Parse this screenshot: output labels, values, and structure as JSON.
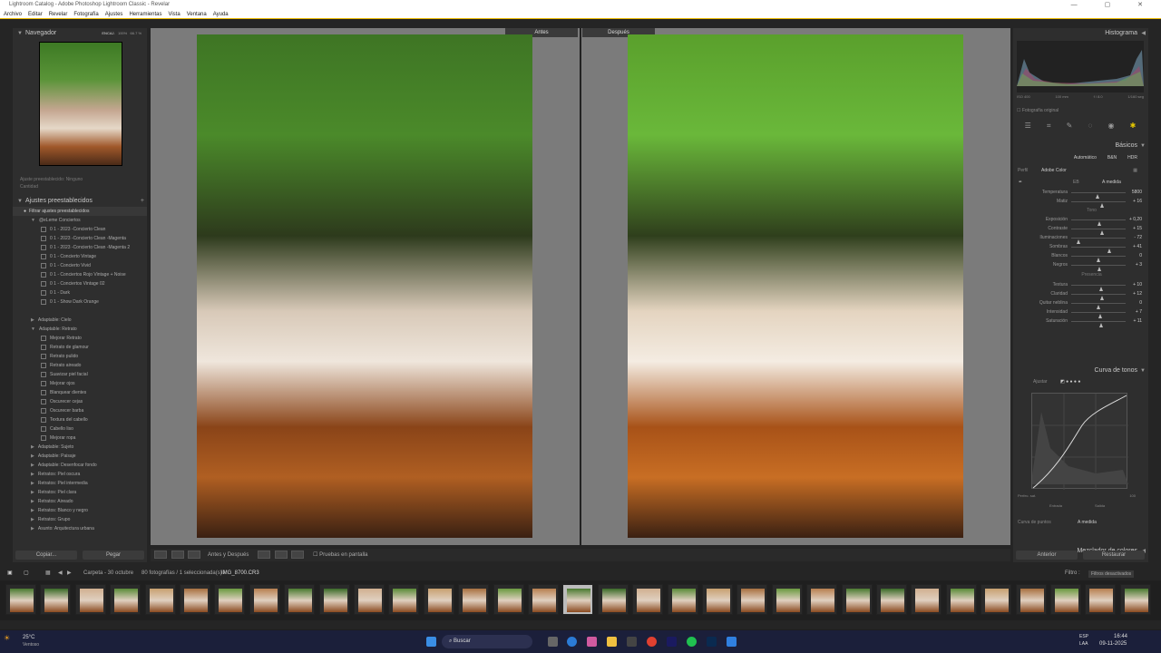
{
  "window": {
    "title": "Lightroom Catalog - Adobe Photoshop Lightroom Classic - Revelar"
  },
  "menu": [
    "Archivo",
    "Editar",
    "Revelar",
    "Fotografía",
    "Ajustes",
    "Herramientas",
    "Vista",
    "Ventana",
    "Ayuda"
  ],
  "navigator": {
    "title": "Navegador",
    "zoom_opts": [
      "ENCAJ.",
      "100%",
      "66.7 %"
    ],
    "preset_line1": "Ajuste preestablecido: Ninguno",
    "preset_line2": "Cantidad"
  },
  "presets": {
    "title": "Ajustes preestablecidos",
    "filter": "Filtrar ajustes preestablecidos",
    "rows": [
      {
        "t": "@eLeme Conciertos",
        "l": 1,
        "open": true
      },
      {
        "t": "0 1 - 2023 -Concierto Clean",
        "l": 2
      },
      {
        "t": "0 1 - 2023 -Concierto Clean -Magenta",
        "l": 2
      },
      {
        "t": "0 1 - 2023 -Concierto Clean -Magenta 2",
        "l": 2
      },
      {
        "t": "0 1 - Concierto Vintage",
        "l": 2
      },
      {
        "t": "0 1 - Concierto Vivid",
        "l": 2
      },
      {
        "t": "0 1 - Conciertos Rojo Vintage + Noise",
        "l": 2
      },
      {
        "t": "0 1 - Conciertos Vintage 02",
        "l": 2
      },
      {
        "t": "0 1 - Dark",
        "l": 2
      },
      {
        "t": "0 1 - Show Dark Orange",
        "l": 2
      },
      {
        "t": "",
        "l": 0
      },
      {
        "t": "Adaptable: Cielo",
        "l": 1
      },
      {
        "t": "Adaptable: Retrato",
        "l": 1,
        "open": true
      },
      {
        "t": "Mejorar Retrato",
        "l": 2
      },
      {
        "t": "Retrato de glamour",
        "l": 2
      },
      {
        "t": "Retrato pulido",
        "l": 2
      },
      {
        "t": "Retrato aireado",
        "l": 2
      },
      {
        "t": "Suavizar piel facial",
        "l": 2
      },
      {
        "t": "Mejorar ojos",
        "l": 2
      },
      {
        "t": "Blanquear dientes",
        "l": 2
      },
      {
        "t": "Oscurecer cejas",
        "l": 2
      },
      {
        "t": "Oscurecer barba",
        "l": 2
      },
      {
        "t": "Textura del cabello",
        "l": 2
      },
      {
        "t": "Cabello liso",
        "l": 2
      },
      {
        "t": "Mejorar ropa",
        "l": 2
      },
      {
        "t": "Adaptable: Sujeto",
        "l": 1
      },
      {
        "t": "Adaptable: Paisaje",
        "l": 1
      },
      {
        "t": "Adaptable: Desenfocar fondo",
        "l": 1
      },
      {
        "t": "Retratos: Piel oscura",
        "l": 1
      },
      {
        "t": "Retratos: Piel intermedia",
        "l": 1
      },
      {
        "t": "Retratos: Piel clara",
        "l": 1
      },
      {
        "t": "Retratos: Aireado",
        "l": 1
      },
      {
        "t": "Retratos: Blanco y negro",
        "l": 1
      },
      {
        "t": "Retratos: Grupo",
        "l": 1
      },
      {
        "t": "Asunto: Arquitectura urbana",
        "l": 1
      }
    ]
  },
  "left_buttons": {
    "copy": "Copiar...",
    "paste": "Pegar"
  },
  "compare": {
    "before": "Antes",
    "after": "Después"
  },
  "toolbar": {
    "mode": "Antes y Después",
    "proof": "Pruebas en pantalla"
  },
  "histogram": {
    "title": "Histograma",
    "iso": "ISO 400",
    "focal": "100 mm",
    "aperture": "f / 8.0",
    "shutter": "1/160 seg",
    "original": "Fotografía original"
  },
  "basics": {
    "title": "Básicos",
    "tabs": [
      "Automático",
      "B&N",
      "HDR"
    ],
    "profile_label": "Perfil",
    "profile_value": "Adobe Color",
    "wb_label": "EB",
    "wb_value": "A medida",
    "temp": {
      "label": "Temperatura",
      "value": "5800",
      "pos": 0.48
    },
    "tint": {
      "label": "Matiz",
      "value": "+ 16",
      "pos": 0.56
    },
    "tone_label": "Tono",
    "tone": [
      {
        "label": "Exposición",
        "value": "+ 0,20",
        "pos": 0.52
      },
      {
        "label": "Contraste",
        "value": "+ 15",
        "pos": 0.57
      },
      {
        "label": "Iluminaciones",
        "value": "- 72",
        "pos": 0.14
      },
      {
        "label": "Sombras",
        "value": "+ 41",
        "pos": 0.7
      },
      {
        "label": "Blancos",
        "value": "0",
        "pos": 0.5
      },
      {
        "label": "Negros",
        "value": "+ 3",
        "pos": 0.51
      }
    ],
    "presence_label": "Presencia",
    "presence": [
      {
        "label": "Textura",
        "value": "+ 10",
        "pos": 0.55
      },
      {
        "label": "Claridad",
        "value": "+ 12",
        "pos": 0.56
      },
      {
        "label": "Quitar neblina",
        "value": "0",
        "pos": 0.5
      },
      {
        "label": "Intensidad",
        "value": "+ 7",
        "pos": 0.53
      },
      {
        "label": "Saturación",
        "value": "+ 11",
        "pos": 0.55
      }
    ]
  },
  "tone_curve": {
    "title": "Curva de tonos",
    "adjust": "Ajustar",
    "perfect": "Perfec. sat.",
    "perfect_val": "100",
    "entrada": "Entrada",
    "salida": "Salida",
    "points_label": "Curva de puntos",
    "points_value": "A medida"
  },
  "mixer": {
    "title": "Mezclador de colores"
  },
  "right_buttons": {
    "previous": "Anterior",
    "reset": "Restaurar"
  },
  "filmbar": {
    "folder": "Carpeta - 30 octubre",
    "count": "80 fotografías / 1 seleccionada(s) /",
    "file": "IMG_8700.CR3",
    "filter_label": "Filtro :",
    "filter_value": "Filtros desactivados"
  },
  "taskbar": {
    "temp": "25°C",
    "weather": "Ventoso",
    "search": "Buscar",
    "lang1": "ESP",
    "lang2": "LAA",
    "time": "16:44",
    "date": "09-11-2025"
  }
}
